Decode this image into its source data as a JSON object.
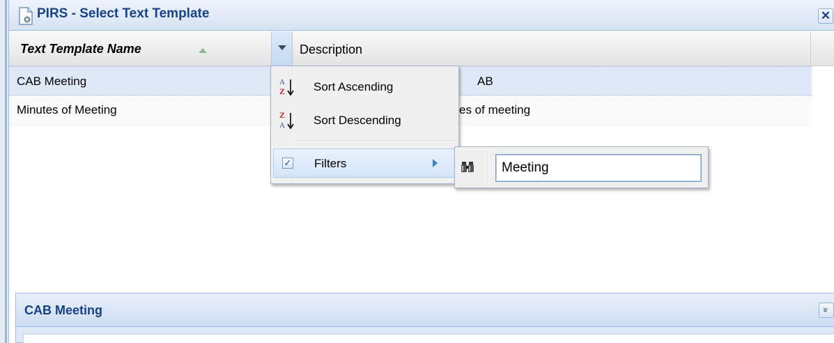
{
  "window": {
    "title": "PIRS - Select Text Template",
    "close_glyph": "✕",
    "icon": "document-gear-icon"
  },
  "grid": {
    "columns": [
      {
        "label": "Text Template Name",
        "sorted": "ascending"
      },
      {
        "label": "Description"
      }
    ],
    "rows": [
      {
        "name": "CAB Meeting",
        "description": "AB",
        "selected": true
      },
      {
        "name": "Minutes of Meeting",
        "description": "es of meeting",
        "selected": false
      }
    ]
  },
  "column_menu": {
    "items": [
      {
        "label": "Sort Ascending",
        "icon": "sort-ascending-icon"
      },
      {
        "label": "Sort Descending",
        "icon": "sort-descending-icon"
      },
      {
        "label": "Filters",
        "icon": "checkbox-checked-icon",
        "checked": true
      }
    ]
  },
  "filter_submenu": {
    "icon": "binoculars-icon",
    "value": "Meeting"
  },
  "preview_panel": {
    "title": "CAB Meeting",
    "collapse_glyph": "»"
  },
  "colors": {
    "title_text": "#15428b",
    "selected_row": "#dfe8f6",
    "border": "#99bbe8"
  }
}
